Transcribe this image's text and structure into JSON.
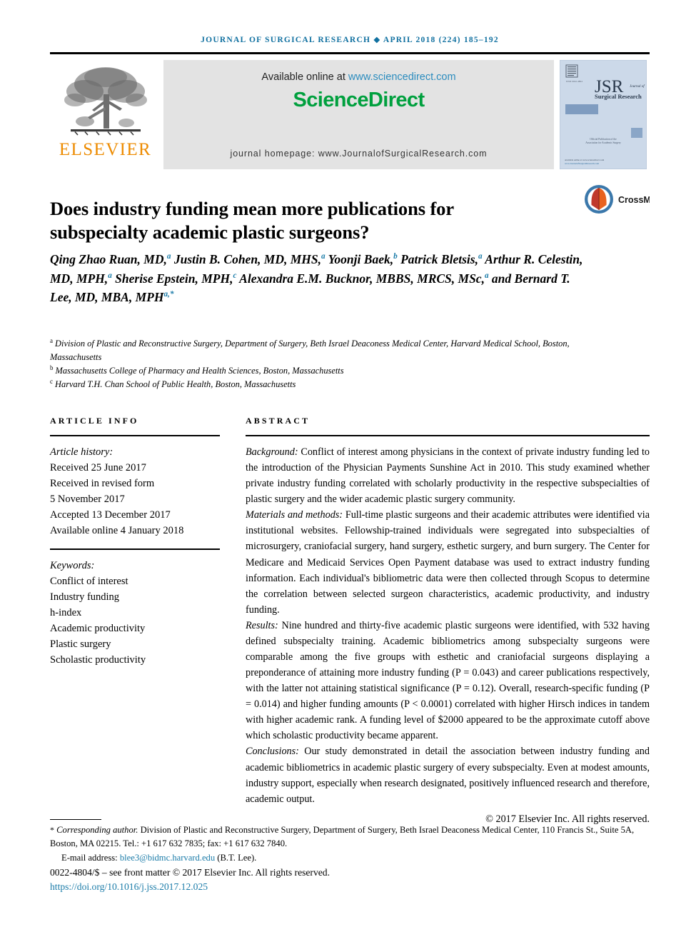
{
  "running_head": "Journal of Surgical Research ◆ April 2018 (224) 185–192",
  "masthead": {
    "publisher_name": "ELSEVIER",
    "publisher_logo_alt": "elsevier-tree-logo",
    "available_prefix": "Available online at ",
    "available_url": "www.sciencedirect.com",
    "sciencedirect_logo": "ScienceDirect",
    "homepage_line": "journal homepage: www.JournalofSurgicalResearch.com",
    "cover": {
      "acronym": "JSR",
      "journal_word": "Journal of",
      "journal_sub": "Surgical Research",
      "cover_note_line1": "Official Publication of the",
      "cover_note_line2": "Association for Academic Surgery",
      "cover_footer_line1": "Available online at www.sciencedirect.com",
      "cover_footer_line2": "www.JournalofSurgicalResearch.com"
    }
  },
  "article": {
    "title": "Does industry funding mean more publications for subspecialty academic plastic surgeons?",
    "crossmark_label": "CrossMark"
  },
  "authors_html": "Qing Zhao Ruan, MD,<sup>a</sup> Justin B. Cohen, MD, MHS,<sup>a</sup> Yoonji Baek,<sup>b</sup> Patrick Bletsis,<sup>a</sup> Arthur R. Celestin, MD, MPH,<sup>a</sup> Sherise Epstein, MPH,<sup>c</sup> Alexandra E.M. Bucknor, MBBS, MRCS, MSc,<sup>a</sup> and Bernard T. Lee, MD, MBA, MPH<sup>a,*</sup>",
  "authors_plain": "Qing Zhao Ruan, MD,a Justin B. Cohen, MD, MHS,a Yoonji Baek,b Patrick Bletsis,a Arthur R. Celestin, MD, MPH,a Sherise Epstein, MPH,c Alexandra E.M. Bucknor, MBBS, MRCS, MSc,a and Bernard T. Lee, MD, MBA, MPHa,*",
  "affiliations_html": "<span class=\"aff-line\"><sup>a</sup> Division of Plastic and Reconstructive Surgery, Department of Surgery, Beth Israel Deaconess Medical Center, Harvard Medical School, Boston, Massachusetts</span><span class=\"aff-line\"><sup>b</sup> Massachusetts College of Pharmacy and Health Sciences, Boston, Massachusetts</span><span class=\"aff-line\"><sup>c</sup> Harvard T.H. Chan School of Public Health, Boston, Massachusetts</span>",
  "affiliations": [
    "a Division of Plastic and Reconstructive Surgery, Department of Surgery, Beth Israel Deaconess Medical Center, Harvard Medical School, Boston, Massachusetts",
    "b Massachusetts College of Pharmacy and Health Sciences, Boston, Massachusetts",
    "c Harvard T.H. Chan School of Public Health, Boston, Massachusetts"
  ],
  "article_info": {
    "heading": "ARTICLE INFO",
    "history_label": "Article history:",
    "history": [
      "Received 25 June 2017",
      "Received in revised form",
      "5 November 2017",
      "Accepted 13 December 2017",
      "Available online 4 January 2018"
    ],
    "keywords_label": "Keywords:",
    "keywords": [
      "Conflict of interest",
      "Industry funding",
      "h-index",
      "Academic productivity",
      "Plastic surgery",
      "Scholastic productivity"
    ]
  },
  "abstract": {
    "heading": "ABSTRACT",
    "sections": [
      {
        "label": "Background:",
        "text": " Conflict of interest among physicians in the context of private industry funding led to the introduction of the Physician Payments Sunshine Act in 2010. This study examined whether private industry funding correlated with scholarly productivity in the respective subspecialties of plastic surgery and the wider academic plastic surgery community."
      },
      {
        "label": "Materials and methods:",
        "text": " Full-time plastic surgeons and their academic attributes were identified via institutional websites. Fellowship-trained individuals were segregated into subspecialties of microsurgery, craniofacial surgery, hand surgery, esthetic surgery, and burn surgery. The Center for Medicare and Medicaid Services Open Payment database was used to extract industry funding information. Each individual's bibliometric data were then collected through Scopus to determine the correlation between selected surgeon characteristics, academic productivity, and industry funding."
      },
      {
        "label": "Results:",
        "text": " Nine hundred and thirty-five academic plastic surgeons were identified, with 532 having defined subspecialty training. Academic bibliometrics among subspecialty surgeons were comparable among the five groups with esthetic and craniofacial surgeons displaying a preponderance of attaining more industry funding (P = 0.043) and career publications respectively, with the latter not attaining statistical significance (P = 0.12). Overall, research-specific funding (P = 0.014) and higher funding amounts (P < 0.0001) correlated with higher Hirsch indices in tandem with higher academic rank. A funding level of $2000 appeared to be the approximate cutoff above which scholastic productivity became apparent."
      },
      {
        "label": "Conclusions:",
        "text": " Our study demonstrated in detail the association between industry funding and academic bibliometrics in academic plastic surgery of every subspecialty. Even at modest amounts, industry support, especially when research designated, positively influenced research and therefore, academic output."
      }
    ],
    "copyright": "© 2017 Elsevier Inc. All rights reserved."
  },
  "footer": {
    "corresponding_marker": "*",
    "corresponding_label": "Corresponding author.",
    "corresponding_address": " Division of Plastic and Reconstructive Surgery, Department of Surgery, Beth Israel Deaconess Medical Center, 110 Francis St., Suite 5A, Boston, MA 02215. Tel.: +1 617 632 7835; fax: +1 617 632 7840.",
    "email_label": "E-mail address:",
    "email": "blee3@bidmc.harvard.edu",
    "email_owner": "(B.T. Lee).",
    "issn_line": "0022-4804/$ – see front matter © 2017 Elsevier Inc. All rights reserved.",
    "doi": "https://doi.org/10.1016/j.jss.2017.12.025"
  },
  "colors": {
    "running_head": "#1070a0",
    "link": "#1a7ba8",
    "sciencedirect_green": "#00a03e",
    "elsevier_orange": "#ED8B00",
    "band_gray": "#e3e3e3",
    "cover_blue": "#c8d6e8"
  }
}
